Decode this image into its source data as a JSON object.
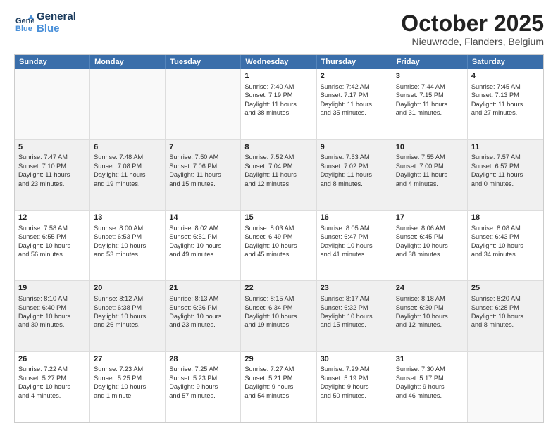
{
  "logo": {
    "line1": "General",
    "line2": "Blue"
  },
  "title": "October 2025",
  "subtitle": "Nieuwrode, Flanders, Belgium",
  "header_days": [
    "Sunday",
    "Monday",
    "Tuesday",
    "Wednesday",
    "Thursday",
    "Friday",
    "Saturday"
  ],
  "rows": [
    [
      {
        "num": "",
        "lines": []
      },
      {
        "num": "",
        "lines": []
      },
      {
        "num": "",
        "lines": []
      },
      {
        "num": "1",
        "lines": [
          "Sunrise: 7:40 AM",
          "Sunset: 7:19 PM",
          "Daylight: 11 hours",
          "and 38 minutes."
        ]
      },
      {
        "num": "2",
        "lines": [
          "Sunrise: 7:42 AM",
          "Sunset: 7:17 PM",
          "Daylight: 11 hours",
          "and 35 minutes."
        ]
      },
      {
        "num": "3",
        "lines": [
          "Sunrise: 7:44 AM",
          "Sunset: 7:15 PM",
          "Daylight: 11 hours",
          "and 31 minutes."
        ]
      },
      {
        "num": "4",
        "lines": [
          "Sunrise: 7:45 AM",
          "Sunset: 7:13 PM",
          "Daylight: 11 hours",
          "and 27 minutes."
        ]
      }
    ],
    [
      {
        "num": "5",
        "lines": [
          "Sunrise: 7:47 AM",
          "Sunset: 7:10 PM",
          "Daylight: 11 hours",
          "and 23 minutes."
        ]
      },
      {
        "num": "6",
        "lines": [
          "Sunrise: 7:48 AM",
          "Sunset: 7:08 PM",
          "Daylight: 11 hours",
          "and 19 minutes."
        ]
      },
      {
        "num": "7",
        "lines": [
          "Sunrise: 7:50 AM",
          "Sunset: 7:06 PM",
          "Daylight: 11 hours",
          "and 15 minutes."
        ]
      },
      {
        "num": "8",
        "lines": [
          "Sunrise: 7:52 AM",
          "Sunset: 7:04 PM",
          "Daylight: 11 hours",
          "and 12 minutes."
        ]
      },
      {
        "num": "9",
        "lines": [
          "Sunrise: 7:53 AM",
          "Sunset: 7:02 PM",
          "Daylight: 11 hours",
          "and 8 minutes."
        ]
      },
      {
        "num": "10",
        "lines": [
          "Sunrise: 7:55 AM",
          "Sunset: 7:00 PM",
          "Daylight: 11 hours",
          "and 4 minutes."
        ]
      },
      {
        "num": "11",
        "lines": [
          "Sunrise: 7:57 AM",
          "Sunset: 6:57 PM",
          "Daylight: 11 hours",
          "and 0 minutes."
        ]
      }
    ],
    [
      {
        "num": "12",
        "lines": [
          "Sunrise: 7:58 AM",
          "Sunset: 6:55 PM",
          "Daylight: 10 hours",
          "and 56 minutes."
        ]
      },
      {
        "num": "13",
        "lines": [
          "Sunrise: 8:00 AM",
          "Sunset: 6:53 PM",
          "Daylight: 10 hours",
          "and 53 minutes."
        ]
      },
      {
        "num": "14",
        "lines": [
          "Sunrise: 8:02 AM",
          "Sunset: 6:51 PM",
          "Daylight: 10 hours",
          "and 49 minutes."
        ]
      },
      {
        "num": "15",
        "lines": [
          "Sunrise: 8:03 AM",
          "Sunset: 6:49 PM",
          "Daylight: 10 hours",
          "and 45 minutes."
        ]
      },
      {
        "num": "16",
        "lines": [
          "Sunrise: 8:05 AM",
          "Sunset: 6:47 PM",
          "Daylight: 10 hours",
          "and 41 minutes."
        ]
      },
      {
        "num": "17",
        "lines": [
          "Sunrise: 8:06 AM",
          "Sunset: 6:45 PM",
          "Daylight: 10 hours",
          "and 38 minutes."
        ]
      },
      {
        "num": "18",
        "lines": [
          "Sunrise: 8:08 AM",
          "Sunset: 6:43 PM",
          "Daylight: 10 hours",
          "and 34 minutes."
        ]
      }
    ],
    [
      {
        "num": "19",
        "lines": [
          "Sunrise: 8:10 AM",
          "Sunset: 6:40 PM",
          "Daylight: 10 hours",
          "and 30 minutes."
        ]
      },
      {
        "num": "20",
        "lines": [
          "Sunrise: 8:12 AM",
          "Sunset: 6:38 PM",
          "Daylight: 10 hours",
          "and 26 minutes."
        ]
      },
      {
        "num": "21",
        "lines": [
          "Sunrise: 8:13 AM",
          "Sunset: 6:36 PM",
          "Daylight: 10 hours",
          "and 23 minutes."
        ]
      },
      {
        "num": "22",
        "lines": [
          "Sunrise: 8:15 AM",
          "Sunset: 6:34 PM",
          "Daylight: 10 hours",
          "and 19 minutes."
        ]
      },
      {
        "num": "23",
        "lines": [
          "Sunrise: 8:17 AM",
          "Sunset: 6:32 PM",
          "Daylight: 10 hours",
          "and 15 minutes."
        ]
      },
      {
        "num": "24",
        "lines": [
          "Sunrise: 8:18 AM",
          "Sunset: 6:30 PM",
          "Daylight: 10 hours",
          "and 12 minutes."
        ]
      },
      {
        "num": "25",
        "lines": [
          "Sunrise: 8:20 AM",
          "Sunset: 6:28 PM",
          "Daylight: 10 hours",
          "and 8 minutes."
        ]
      }
    ],
    [
      {
        "num": "26",
        "lines": [
          "Sunrise: 7:22 AM",
          "Sunset: 5:27 PM",
          "Daylight: 10 hours",
          "and 4 minutes."
        ]
      },
      {
        "num": "27",
        "lines": [
          "Sunrise: 7:23 AM",
          "Sunset: 5:25 PM",
          "Daylight: 10 hours",
          "and 1 minute."
        ]
      },
      {
        "num": "28",
        "lines": [
          "Sunrise: 7:25 AM",
          "Sunset: 5:23 PM",
          "Daylight: 9 hours",
          "and 57 minutes."
        ]
      },
      {
        "num": "29",
        "lines": [
          "Sunrise: 7:27 AM",
          "Sunset: 5:21 PM",
          "Daylight: 9 hours",
          "and 54 minutes."
        ]
      },
      {
        "num": "30",
        "lines": [
          "Sunrise: 7:29 AM",
          "Sunset: 5:19 PM",
          "Daylight: 9 hours",
          "and 50 minutes."
        ]
      },
      {
        "num": "31",
        "lines": [
          "Sunrise: 7:30 AM",
          "Sunset: 5:17 PM",
          "Daylight: 9 hours",
          "and 46 minutes."
        ]
      },
      {
        "num": "",
        "lines": []
      }
    ]
  ]
}
